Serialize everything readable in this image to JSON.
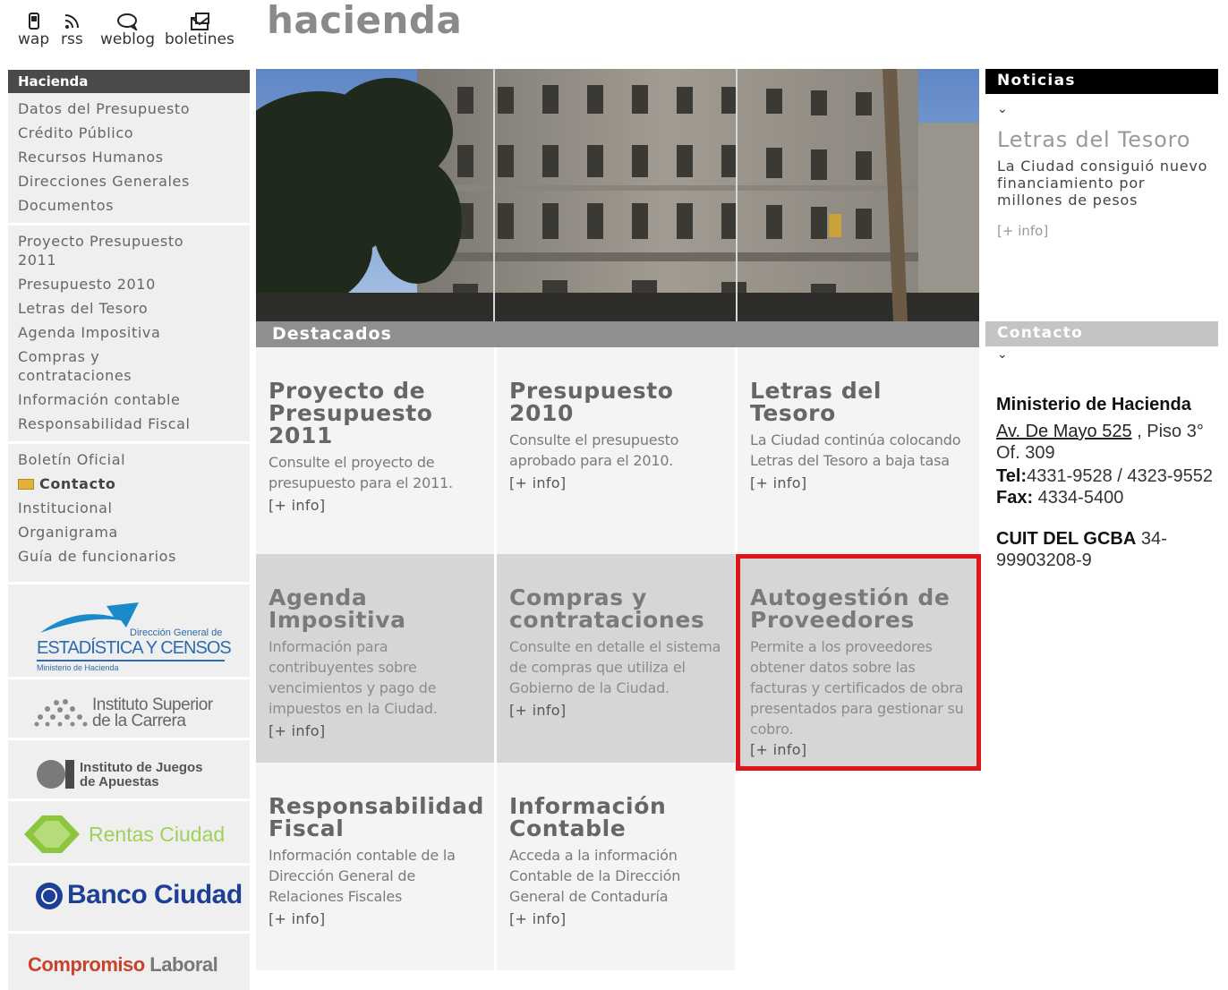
{
  "top_links": [
    {
      "label": "wap",
      "icon": "phone-icon"
    },
    {
      "label": "rss",
      "icon": "rss-icon"
    },
    {
      "label": "weblog",
      "icon": "chat-bubble-icon"
    },
    {
      "label": "boletines",
      "icon": "newsletter-icon"
    }
  ],
  "site_title": "hacienda",
  "sidebar": {
    "header": "Hacienda",
    "group1": [
      "Datos del Presupuesto",
      "Crédito Público",
      "Recursos Humanos",
      "Direcciones Generales",
      "Documentos"
    ],
    "group2": [
      "Proyecto Presupuesto 2011",
      "Presupuesto 2010",
      "Letras del Tesoro",
      "Agenda Impositiva",
      "Compras y contrataciones",
      "Información contable",
      "Responsabilidad Fiscal"
    ],
    "group3": [
      "Boletín Oficial",
      "Contacto",
      "Institucional",
      "Organigrama",
      "Guía de funcionarios"
    ]
  },
  "logos": {
    "estadistica_small": "Dirección General de",
    "estadistica_main": "ESTADÍSTICA Y CENSOS",
    "estadistica_sub": "Ministerio de Hacienda",
    "isc_line1": "Instituto Superior",
    "isc_line2": "de la Carrera",
    "iaf_line1": "Instituto de Juegos",
    "iaf_line2": "de Apuestas",
    "rentas": "Rentas Ciudad",
    "banco": "Banco Ciudad",
    "compromiso_a": "Compromiso",
    "compromiso_b": " Laboral"
  },
  "destacados_label": "Destacados",
  "tiles": [
    {
      "title": "Proyecto de Presupuesto 2011",
      "desc": "Consulte el proyecto de presupuesto para el 2011.",
      "link": "[+ info]"
    },
    {
      "title": "Presupuesto 2010",
      "desc": "Consulte el presupuesto aprobado para el 2010.",
      "link": "[+ info]"
    },
    {
      "title": "Letras del Tesoro",
      "desc": "La Ciudad continúa colocando Letras del Tesoro a baja tasa",
      "link": "[+ info]"
    },
    {
      "title": "Agenda Impositiva",
      "desc": "Información para contribuyentes sobre vencimientos y pago de impuestos en la Ciudad.",
      "link": "[+ info]"
    },
    {
      "title": "Compras y contrataciones",
      "desc": "Consulte en detalle el sistema de compras que utiliza el Gobierno de la Ciudad.",
      "link": "[+ info]"
    },
    {
      "title": "Autogestión de Proveedores",
      "desc": "Permite a los proveedores obtener datos sobre las facturas y certificados de obra presentados para gestionar su cobro.",
      "link": "[+ info]"
    },
    {
      "title": "Responsabilidad Fiscal",
      "desc": "Información contable de la Dirección General de Relaciones Fiscales",
      "link": "[+ info]"
    },
    {
      "title": "Información Contable",
      "desc": "Acceda a la información Contable de la Dirección General de Contaduría",
      "link": "[+ info]"
    }
  ],
  "noticias": {
    "header": "Noticias",
    "title": "Letras del Tesoro",
    "desc": "La Ciudad consiguió nuevo financiamiento por millones de pesos",
    "link": "[+ info]"
  },
  "contacto": {
    "header": "Contacto",
    "org": "Ministerio de Hacienda",
    "address_link": "Av. De Mayo 525",
    "address_rest": " , Piso 3° Of. 309",
    "tel_label": "Tel:",
    "tel": "4331-9528 / 4323-9552",
    "fax_label": "Fax:",
    "fax": " 4334-5400",
    "cuit_label": "CUIT DEL GCBA",
    "cuit": " 34-99903208-9"
  },
  "colors": {
    "highlight": "#e0141a",
    "sidebar_header": "#4a4a4a",
    "destacados_bar": "#8f8f8f",
    "banco_blue": "#1d3f95",
    "rentas_green": "#8cc63f",
    "compromiso_red": "#c8432b"
  }
}
